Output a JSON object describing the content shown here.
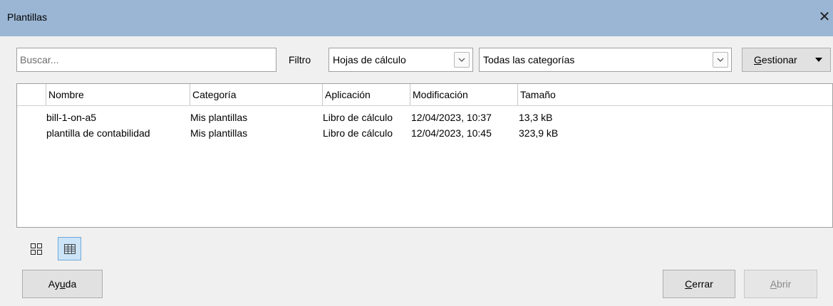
{
  "window": {
    "title": "Plantillas",
    "close_glyph": "✕"
  },
  "search": {
    "placeholder": "Buscar...",
    "value": ""
  },
  "filter": {
    "label": "Filtro",
    "type_value": "Hojas de cálculo",
    "category_value": "Todas las categorías"
  },
  "manage": {
    "label_first": "G",
    "label_rest": "estionar"
  },
  "table": {
    "columns": [
      "Nombre",
      "Categoría",
      "Aplicación",
      "Modificación",
      "Tamaño"
    ],
    "rows": [
      [
        "bill-1-on-a5",
        "Mis plantillas",
        "Libro de cálculo",
        "12/04/2023, 10:37",
        "13,3 kB"
      ],
      [
        "plantilla de contabilidad",
        "Mis plantillas",
        "Libro de cálculo",
        "12/04/2023, 10:45",
        "323,9 kB"
      ]
    ]
  },
  "view": {
    "thumbnail_icon": "thumbnail-view-icon",
    "list_icon": "list-view-icon",
    "active": "list"
  },
  "buttons": {
    "help_pre": "Ay",
    "help_ul": "u",
    "help_post": "da",
    "close_ul": "C",
    "close_post": "errar",
    "open_ul": "A",
    "open_post": "brir"
  },
  "colors": {
    "titlebar": "#9ab6d4",
    "active_toggle": "#cce4f7"
  }
}
